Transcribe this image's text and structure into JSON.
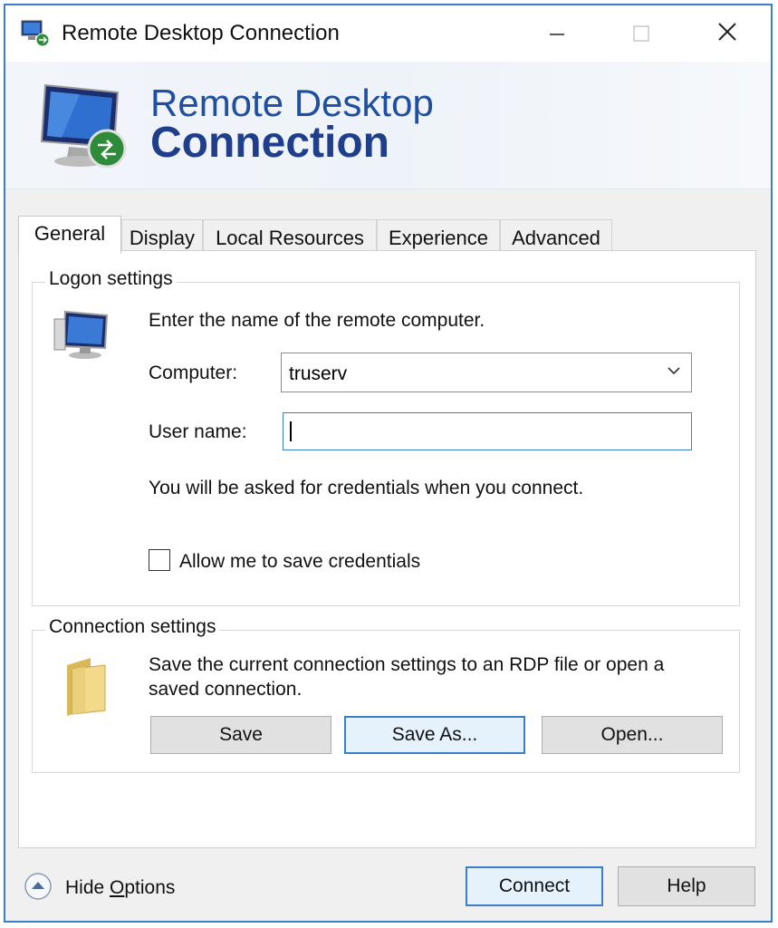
{
  "window": {
    "title": "Remote Desktop Connection",
    "controls": {
      "minimize": "—",
      "maximize": "☐",
      "close": "✕"
    }
  },
  "banner": {
    "line1": "Remote Desktop",
    "line2": "Connection"
  },
  "tabs": [
    {
      "label": "General",
      "active": true
    },
    {
      "label": "Display",
      "active": false
    },
    {
      "label": "Local Resources",
      "active": false
    },
    {
      "label": "Experience",
      "active": false
    },
    {
      "label": "Advanced",
      "active": false
    }
  ],
  "logon": {
    "legend": "Logon settings",
    "instruction": "Enter the name of the remote computer.",
    "computer_label": "Computer:",
    "computer_value": "truserv",
    "username_label": "User name:",
    "username_value": "",
    "credentials_note": "You will be asked for credentials when you connect.",
    "save_credentials_label": "Allow me to save credentials",
    "save_credentials_checked": false
  },
  "connection": {
    "legend": "Connection settings",
    "description_line1": "Save the current connection settings to an RDP file or open a",
    "description_line2": "saved connection.",
    "save_label": "Save",
    "save_as_label": "Save As...",
    "open_label": "Open..."
  },
  "footer": {
    "hide_options_prefix": "Hide ",
    "hide_options_accel": "O",
    "hide_options_suffix": "ptions",
    "connect_label": "Connect",
    "help_label": "Help"
  },
  "icons": {
    "app": "remote-desktop-icon",
    "banner": "monitor-connection-icon",
    "logon": "computer-icon",
    "connection": "folder-icon",
    "hide_options": "chevron-up-circle-icon"
  }
}
